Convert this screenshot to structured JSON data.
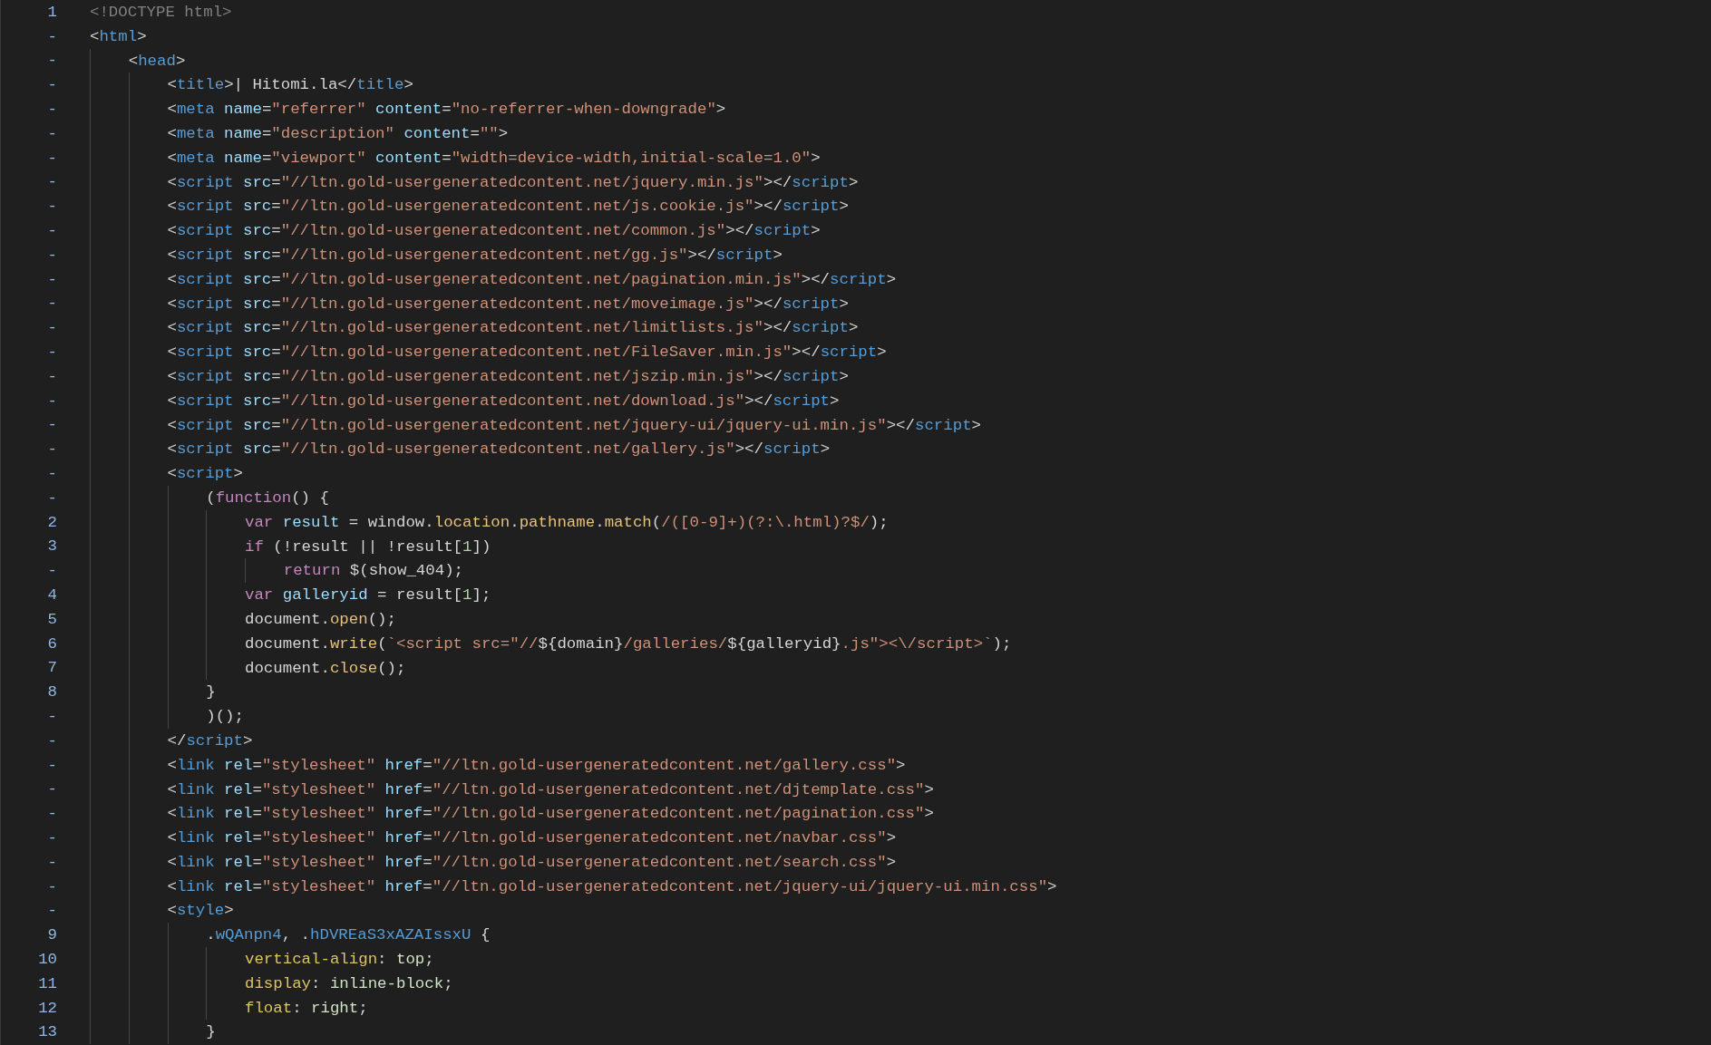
{
  "editor": {
    "lines": [
      {
        "gutter": "1",
        "tokens": [
          {
            "kind": "doc",
            "text": "<!DOCTYPE html>"
          }
        ]
      },
      {
        "gutter": "-",
        "tokens": [
          {
            "kind": "p",
            "text": "<"
          },
          {
            "kind": "tag",
            "text": "html"
          },
          {
            "kind": "p",
            "text": ">"
          }
        ]
      },
      {
        "gutter": "-",
        "tokens": [
          {
            "kind": "p",
            "text": "    <"
          },
          {
            "kind": "tag",
            "text": "head"
          },
          {
            "kind": "p",
            "text": ">"
          }
        ]
      },
      {
        "gutter": "-",
        "tokens": [
          {
            "kind": "p",
            "text": "        <"
          },
          {
            "kind": "tag",
            "text": "title"
          },
          {
            "kind": "p",
            "text": ">| Hitomi.la</"
          },
          {
            "kind": "tag",
            "text": "title"
          },
          {
            "kind": "p",
            "text": ">"
          }
        ]
      },
      {
        "gutter": "-",
        "tokens": [
          {
            "kind": "p",
            "text": "        <"
          },
          {
            "kind": "tag",
            "text": "meta"
          },
          {
            "kind": "attr",
            "text": " name"
          },
          {
            "kind": "p",
            "text": "="
          },
          {
            "kind": "str",
            "text": "\"referrer\""
          },
          {
            "kind": "attr",
            "text": " content"
          },
          {
            "kind": "p",
            "text": "="
          },
          {
            "kind": "str",
            "text": "\"no-referrer-when-downgrade\""
          },
          {
            "kind": "p",
            "text": ">"
          }
        ]
      },
      {
        "gutter": "-",
        "tokens": [
          {
            "kind": "p",
            "text": "        <"
          },
          {
            "kind": "tag",
            "text": "meta"
          },
          {
            "kind": "attr",
            "text": " name"
          },
          {
            "kind": "p",
            "text": "="
          },
          {
            "kind": "str",
            "text": "\"description\""
          },
          {
            "kind": "attr",
            "text": " content"
          },
          {
            "kind": "p",
            "text": "="
          },
          {
            "kind": "str",
            "text": "\"\""
          },
          {
            "kind": "p",
            "text": ">"
          }
        ]
      },
      {
        "gutter": "-",
        "tokens": [
          {
            "kind": "p",
            "text": "        <"
          },
          {
            "kind": "tag",
            "text": "meta"
          },
          {
            "kind": "attr",
            "text": " name"
          },
          {
            "kind": "p",
            "text": "="
          },
          {
            "kind": "str",
            "text": "\"viewport\""
          },
          {
            "kind": "attr",
            "text": " content"
          },
          {
            "kind": "p",
            "text": "="
          },
          {
            "kind": "str",
            "text": "\"width=device-width,initial-scale=1.0\""
          },
          {
            "kind": "p",
            "text": ">"
          }
        ]
      },
      {
        "gutter": "-",
        "tokens": [
          {
            "kind": "p",
            "text": "        <"
          },
          {
            "kind": "tag",
            "text": "script"
          },
          {
            "kind": "attr",
            "text": " src"
          },
          {
            "kind": "p",
            "text": "="
          },
          {
            "kind": "str",
            "text": "\"//ltn.gold-usergeneratedcontent.net/jquery.min.js\""
          },
          {
            "kind": "p",
            "text": "></"
          },
          {
            "kind": "tag",
            "text": "script"
          },
          {
            "kind": "p",
            "text": ">"
          }
        ]
      },
      {
        "gutter": "-",
        "tokens": [
          {
            "kind": "p",
            "text": "        <"
          },
          {
            "kind": "tag",
            "text": "script"
          },
          {
            "kind": "attr",
            "text": " src"
          },
          {
            "kind": "p",
            "text": "="
          },
          {
            "kind": "str",
            "text": "\"//ltn.gold-usergeneratedcontent.net/js.cookie.js\""
          },
          {
            "kind": "p",
            "text": "></"
          },
          {
            "kind": "tag",
            "text": "script"
          },
          {
            "kind": "p",
            "text": ">"
          }
        ]
      },
      {
        "gutter": "-",
        "tokens": [
          {
            "kind": "p",
            "text": "        <"
          },
          {
            "kind": "tag",
            "text": "script"
          },
          {
            "kind": "attr",
            "text": " src"
          },
          {
            "kind": "p",
            "text": "="
          },
          {
            "kind": "str",
            "text": "\"//ltn.gold-usergeneratedcontent.net/common.js\""
          },
          {
            "kind": "p",
            "text": "></"
          },
          {
            "kind": "tag",
            "text": "script"
          },
          {
            "kind": "p",
            "text": ">"
          }
        ]
      },
      {
        "gutter": "-",
        "tokens": [
          {
            "kind": "p",
            "text": "        <"
          },
          {
            "kind": "tag",
            "text": "script"
          },
          {
            "kind": "attr",
            "text": " src"
          },
          {
            "kind": "p",
            "text": "="
          },
          {
            "kind": "str",
            "text": "\"//ltn.gold-usergeneratedcontent.net/gg.js\""
          },
          {
            "kind": "p",
            "text": "></"
          },
          {
            "kind": "tag",
            "text": "script"
          },
          {
            "kind": "p",
            "text": ">"
          }
        ]
      },
      {
        "gutter": "-",
        "tokens": [
          {
            "kind": "p",
            "text": "        <"
          },
          {
            "kind": "tag",
            "text": "script"
          },
          {
            "kind": "attr",
            "text": " src"
          },
          {
            "kind": "p",
            "text": "="
          },
          {
            "kind": "str",
            "text": "\"//ltn.gold-usergeneratedcontent.net/pagination.min.js\""
          },
          {
            "kind": "p",
            "text": "></"
          },
          {
            "kind": "tag",
            "text": "script"
          },
          {
            "kind": "p",
            "text": ">"
          }
        ]
      },
      {
        "gutter": "-",
        "tokens": [
          {
            "kind": "p",
            "text": "        <"
          },
          {
            "kind": "tag",
            "text": "script"
          },
          {
            "kind": "attr",
            "text": " src"
          },
          {
            "kind": "p",
            "text": "="
          },
          {
            "kind": "str",
            "text": "\"//ltn.gold-usergeneratedcontent.net/moveimage.js\""
          },
          {
            "kind": "p",
            "text": "></"
          },
          {
            "kind": "tag",
            "text": "script"
          },
          {
            "kind": "p",
            "text": ">"
          }
        ]
      },
      {
        "gutter": "-",
        "tokens": [
          {
            "kind": "p",
            "text": "        <"
          },
          {
            "kind": "tag",
            "text": "script"
          },
          {
            "kind": "attr",
            "text": " src"
          },
          {
            "kind": "p",
            "text": "="
          },
          {
            "kind": "str",
            "text": "\"//ltn.gold-usergeneratedcontent.net/limitlists.js\""
          },
          {
            "kind": "p",
            "text": "></"
          },
          {
            "kind": "tag",
            "text": "script"
          },
          {
            "kind": "p",
            "text": ">"
          }
        ]
      },
      {
        "gutter": "-",
        "tokens": [
          {
            "kind": "p",
            "text": "        <"
          },
          {
            "kind": "tag",
            "text": "script"
          },
          {
            "kind": "attr",
            "text": " src"
          },
          {
            "kind": "p",
            "text": "="
          },
          {
            "kind": "str",
            "text": "\"//ltn.gold-usergeneratedcontent.net/FileSaver.min.js\""
          },
          {
            "kind": "p",
            "text": "></"
          },
          {
            "kind": "tag",
            "text": "script"
          },
          {
            "kind": "p",
            "text": ">"
          }
        ]
      },
      {
        "gutter": "-",
        "tokens": [
          {
            "kind": "p",
            "text": "        <"
          },
          {
            "kind": "tag",
            "text": "script"
          },
          {
            "kind": "attr",
            "text": " src"
          },
          {
            "kind": "p",
            "text": "="
          },
          {
            "kind": "str",
            "text": "\"//ltn.gold-usergeneratedcontent.net/jszip.min.js\""
          },
          {
            "kind": "p",
            "text": "></"
          },
          {
            "kind": "tag",
            "text": "script"
          },
          {
            "kind": "p",
            "text": ">"
          }
        ]
      },
      {
        "gutter": "-",
        "tokens": [
          {
            "kind": "p",
            "text": "        <"
          },
          {
            "kind": "tag",
            "text": "script"
          },
          {
            "kind": "attr",
            "text": " src"
          },
          {
            "kind": "p",
            "text": "="
          },
          {
            "kind": "str",
            "text": "\"//ltn.gold-usergeneratedcontent.net/download.js\""
          },
          {
            "kind": "p",
            "text": "></"
          },
          {
            "kind": "tag",
            "text": "script"
          },
          {
            "kind": "p",
            "text": ">"
          }
        ]
      },
      {
        "gutter": "-",
        "tokens": [
          {
            "kind": "p",
            "text": "        <"
          },
          {
            "kind": "tag",
            "text": "script"
          },
          {
            "kind": "attr",
            "text": " src"
          },
          {
            "kind": "p",
            "text": "="
          },
          {
            "kind": "str",
            "text": "\"//ltn.gold-usergeneratedcontent.net/jquery-ui/jquery-ui.min.js\""
          },
          {
            "kind": "p",
            "text": "></"
          },
          {
            "kind": "tag",
            "text": "script"
          },
          {
            "kind": "p",
            "text": ">"
          }
        ]
      },
      {
        "gutter": "-",
        "tokens": [
          {
            "kind": "p",
            "text": "        <"
          },
          {
            "kind": "tag",
            "text": "script"
          },
          {
            "kind": "attr",
            "text": " src"
          },
          {
            "kind": "p",
            "text": "="
          },
          {
            "kind": "str",
            "text": "\"//ltn.gold-usergeneratedcontent.net/gallery.js\""
          },
          {
            "kind": "p",
            "text": "></"
          },
          {
            "kind": "tag",
            "text": "script"
          },
          {
            "kind": "p",
            "text": ">"
          }
        ]
      },
      {
        "gutter": "-",
        "tokens": [
          {
            "kind": "p",
            "text": "        <"
          },
          {
            "kind": "tag",
            "text": "script"
          },
          {
            "kind": "p",
            "text": ">"
          }
        ]
      },
      {
        "gutter": "-",
        "tokens": [
          {
            "kind": "p",
            "text": "            ("
          },
          {
            "kind": "kw",
            "text": "function"
          },
          {
            "kind": "p",
            "text": "() {"
          }
        ]
      },
      {
        "gutter": "2",
        "tokens": [
          {
            "kind": "kw",
            "text": "                var"
          },
          {
            "kind": "var",
            "text": " result"
          },
          {
            "kind": "p",
            "text": " = window."
          },
          {
            "kind": "fn",
            "text": "location"
          },
          {
            "kind": "p",
            "text": "."
          },
          {
            "kind": "fn",
            "text": "pathname"
          },
          {
            "kind": "p",
            "text": "."
          },
          {
            "kind": "fn",
            "text": "match"
          },
          {
            "kind": "p",
            "text": "("
          },
          {
            "kind": "str",
            "text": "/([0-9]+)(?:\\.html)?$/"
          },
          {
            "kind": "p",
            "text": ");"
          }
        ]
      },
      {
        "gutter": "3",
        "tokens": [
          {
            "kind": "kw",
            "text": "                if"
          },
          {
            "kind": "p",
            "text": " (!result || !result["
          },
          {
            "kind": "num",
            "text": "1"
          },
          {
            "kind": "p",
            "text": "])"
          }
        ]
      },
      {
        "gutter": "-",
        "tokens": [
          {
            "kind": "kw",
            "text": "                    return"
          },
          {
            "kind": "p",
            "text": " $(show_404);"
          }
        ]
      },
      {
        "gutter": "4",
        "tokens": [
          {
            "kind": "kw",
            "text": "                var"
          },
          {
            "kind": "var",
            "text": " galleryid"
          },
          {
            "kind": "p",
            "text": " = result["
          },
          {
            "kind": "num",
            "text": "1"
          },
          {
            "kind": "p",
            "text": "];"
          }
        ]
      },
      {
        "gutter": "5",
        "tokens": [
          {
            "kind": "p",
            "text": "                document."
          },
          {
            "kind": "fn",
            "text": "open"
          },
          {
            "kind": "p",
            "text": "();"
          }
        ]
      },
      {
        "gutter": "6",
        "tokens": [
          {
            "kind": "p",
            "text": "                document."
          },
          {
            "kind": "fn",
            "text": "write"
          },
          {
            "kind": "p",
            "text": "("
          },
          {
            "kind": "str",
            "text": "`<script src=\"//"
          },
          {
            "kind": "p",
            "text": "${domain}"
          },
          {
            "kind": "str",
            "text": "/galleries/"
          },
          {
            "kind": "p",
            "text": "${galleryid}"
          },
          {
            "kind": "str",
            "text": ".js\"><\\/script>`"
          },
          {
            "kind": "p",
            "text": ");"
          }
        ]
      },
      {
        "gutter": "7",
        "tokens": [
          {
            "kind": "p",
            "text": "                document."
          },
          {
            "kind": "fn",
            "text": "close"
          },
          {
            "kind": "p",
            "text": "();"
          }
        ]
      },
      {
        "gutter": "8",
        "tokens": [
          {
            "kind": "p",
            "text": "            }"
          }
        ]
      },
      {
        "gutter": "-",
        "tokens": [
          {
            "kind": "p",
            "text": "            )();"
          }
        ]
      },
      {
        "gutter": "-",
        "tokens": [
          {
            "kind": "p",
            "text": "        </"
          },
          {
            "kind": "tag",
            "text": "script"
          },
          {
            "kind": "p",
            "text": ">"
          }
        ]
      },
      {
        "gutter": "-",
        "tokens": [
          {
            "kind": "p",
            "text": "        <"
          },
          {
            "kind": "tag",
            "text": "link"
          },
          {
            "kind": "attr",
            "text": " rel"
          },
          {
            "kind": "p",
            "text": "="
          },
          {
            "kind": "str",
            "text": "\"stylesheet\""
          },
          {
            "kind": "attr",
            "text": " href"
          },
          {
            "kind": "p",
            "text": "="
          },
          {
            "kind": "str",
            "text": "\"//ltn.gold-usergeneratedcontent.net/gallery.css\""
          },
          {
            "kind": "p",
            "text": ">"
          }
        ]
      },
      {
        "gutter": "-",
        "tokens": [
          {
            "kind": "p",
            "text": "        <"
          },
          {
            "kind": "tag",
            "text": "link"
          },
          {
            "kind": "attr",
            "text": " rel"
          },
          {
            "kind": "p",
            "text": "="
          },
          {
            "kind": "str",
            "text": "\"stylesheet\""
          },
          {
            "kind": "attr",
            "text": " href"
          },
          {
            "kind": "p",
            "text": "="
          },
          {
            "kind": "str",
            "text": "\"//ltn.gold-usergeneratedcontent.net/djtemplate.css\""
          },
          {
            "kind": "p",
            "text": ">"
          }
        ]
      },
      {
        "gutter": "-",
        "tokens": [
          {
            "kind": "p",
            "text": "        <"
          },
          {
            "kind": "tag",
            "text": "link"
          },
          {
            "kind": "attr",
            "text": " rel"
          },
          {
            "kind": "p",
            "text": "="
          },
          {
            "kind": "str",
            "text": "\"stylesheet\""
          },
          {
            "kind": "attr",
            "text": " href"
          },
          {
            "kind": "p",
            "text": "="
          },
          {
            "kind": "str",
            "text": "\"//ltn.gold-usergeneratedcontent.net/pagination.css\""
          },
          {
            "kind": "p",
            "text": ">"
          }
        ]
      },
      {
        "gutter": "-",
        "tokens": [
          {
            "kind": "p",
            "text": "        <"
          },
          {
            "kind": "tag",
            "text": "link"
          },
          {
            "kind": "attr",
            "text": " rel"
          },
          {
            "kind": "p",
            "text": "="
          },
          {
            "kind": "str",
            "text": "\"stylesheet\""
          },
          {
            "kind": "attr",
            "text": " href"
          },
          {
            "kind": "p",
            "text": "="
          },
          {
            "kind": "str",
            "text": "\"//ltn.gold-usergeneratedcontent.net/navbar.css\""
          },
          {
            "kind": "p",
            "text": ">"
          }
        ]
      },
      {
        "gutter": "-",
        "tokens": [
          {
            "kind": "p",
            "text": "        <"
          },
          {
            "kind": "tag",
            "text": "link"
          },
          {
            "kind": "attr",
            "text": " rel"
          },
          {
            "kind": "p",
            "text": "="
          },
          {
            "kind": "str",
            "text": "\"stylesheet\""
          },
          {
            "kind": "attr",
            "text": " href"
          },
          {
            "kind": "p",
            "text": "="
          },
          {
            "kind": "str",
            "text": "\"//ltn.gold-usergeneratedcontent.net/search.css\""
          },
          {
            "kind": "p",
            "text": ">"
          }
        ]
      },
      {
        "gutter": "-",
        "tokens": [
          {
            "kind": "p",
            "text": "        <"
          },
          {
            "kind": "tag",
            "text": "link"
          },
          {
            "kind": "attr",
            "text": " rel"
          },
          {
            "kind": "p",
            "text": "="
          },
          {
            "kind": "str",
            "text": "\"stylesheet\""
          },
          {
            "kind": "attr",
            "text": " href"
          },
          {
            "kind": "p",
            "text": "="
          },
          {
            "kind": "str",
            "text": "\"//ltn.gold-usergeneratedcontent.net/jquery-ui/jquery-ui.min.css\""
          },
          {
            "kind": "p",
            "text": ">"
          }
        ]
      },
      {
        "gutter": "-",
        "tokens": [
          {
            "kind": "p",
            "text": "        <"
          },
          {
            "kind": "tag",
            "text": "style"
          },
          {
            "kind": "p",
            "text": ">"
          }
        ]
      },
      {
        "gutter": "9",
        "tokens": [
          {
            "kind": "p",
            "text": "            ."
          },
          {
            "kind": "sel",
            "text": "wQAnpn4"
          },
          {
            "kind": "p",
            "text": ", ."
          },
          {
            "kind": "sel",
            "text": "hDVREaS3xAZAIssxU"
          },
          {
            "kind": "p",
            "text": " {"
          }
        ]
      },
      {
        "gutter": "10",
        "tokens": [
          {
            "kind": "prop",
            "text": "                vertical-align"
          },
          {
            "kind": "p",
            "text": ": "
          },
          {
            "kind": "val",
            "text": "top"
          },
          {
            "kind": "p",
            "text": ";"
          }
        ]
      },
      {
        "gutter": "11",
        "tokens": [
          {
            "kind": "prop",
            "text": "                display"
          },
          {
            "kind": "p",
            "text": ": "
          },
          {
            "kind": "val",
            "text": "inline-block"
          },
          {
            "kind": "p",
            "text": ";"
          }
        ]
      },
      {
        "gutter": "12",
        "tokens": [
          {
            "kind": "prop",
            "text": "                float"
          },
          {
            "kind": "p",
            "text": ": "
          },
          {
            "kind": "val",
            "text": "right"
          },
          {
            "kind": "p",
            "text": ";"
          }
        ]
      },
      {
        "gutter": "13",
        "tokens": [
          {
            "kind": "p",
            "text": "            }"
          }
        ]
      }
    ]
  }
}
